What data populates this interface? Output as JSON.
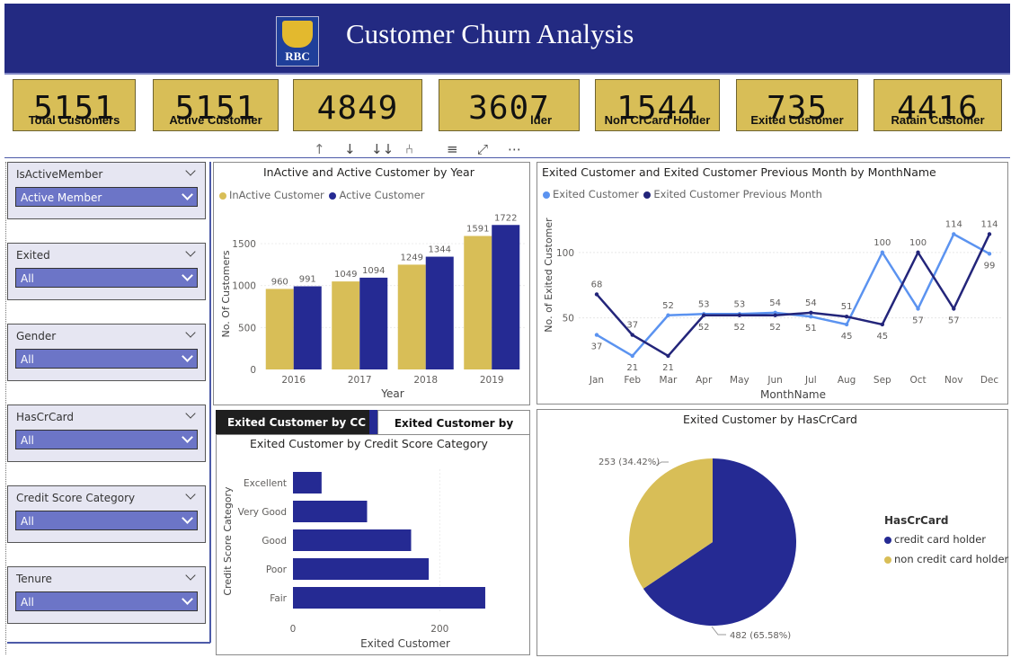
{
  "header": {
    "title": "Customer Churn Analysis",
    "logo_text": "RBC"
  },
  "kpis": [
    {
      "value": "5151",
      "label": "Total Customers"
    },
    {
      "value": "5151",
      "label": "Active Customer"
    },
    {
      "value": "4849",
      "label": ""
    },
    {
      "value": "3607",
      "label": "lder"
    },
    {
      "value": "1544",
      "label": "Non CrCard Holder"
    },
    {
      "value": "735",
      "label": "Exited Customer"
    },
    {
      "value": "4416",
      "label": "Ratain Customer"
    }
  ],
  "slicers": [
    {
      "title": "IsActiveMember",
      "value": "Active Member"
    },
    {
      "title": "Exited",
      "value": "All"
    },
    {
      "title": "Gender",
      "value": "All"
    },
    {
      "title": "HasCrCard",
      "value": "All"
    },
    {
      "title": "Credit Score Category",
      "value": "All"
    },
    {
      "title": "Tenure",
      "value": "All"
    }
  ],
  "toolbar": {
    "icons": [
      "arrow-up-icon",
      "arrow-down-icon",
      "double-arrow-down-icon",
      "expand-hierarchy-icon",
      "filter-icon",
      "focus-mode-icon",
      "more-options-icon"
    ]
  },
  "tabs": {
    "active": "Exited Customer by CC Cat",
    "inactive": "Exited Customer by Gender"
  },
  "colors": {
    "navy": "#252a93",
    "gold": "#d8be57",
    "light_blue": "#5b93f0",
    "dark_navy": "#23257a"
  },
  "chart_data": [
    {
      "type": "bar",
      "title": "InActive and Active Customer by Year",
      "xlabel": "Year",
      "ylabel": "No. Of Customers",
      "categories": [
        "2016",
        "2017",
        "2018",
        "2019"
      ],
      "series": [
        {
          "name": "InActive Customer",
          "values": [
            960,
            1049,
            1249,
            1591
          ]
        },
        {
          "name": "Active Customer",
          "values": [
            991,
            1094,
            1344,
            1722
          ]
        }
      ],
      "ylim": [
        0,
        1800
      ],
      "yticks": [
        "0",
        "500",
        "1000",
        "1500"
      ],
      "legend": "top-left"
    },
    {
      "type": "line",
      "title": "Exited Customer and Exited Customer Previous Month by MonthName",
      "xlabel": "MonthName",
      "ylabel": "No. of Exited Customer",
      "categories": [
        "Jan",
        "Feb",
        "Mar",
        "Apr",
        "May",
        "Jun",
        "Jul",
        "Aug",
        "Sep",
        "Oct",
        "Nov",
        "Dec"
      ],
      "series": [
        {
          "name": "Exited Customer",
          "values": [
            37,
            21,
            52,
            53,
            53,
            54,
            51,
            45,
            100,
            57,
            114,
            99
          ]
        },
        {
          "name": "Exited Customer Previous Month",
          "values": [
            68,
            37,
            21,
            52,
            52,
            52,
            54,
            51,
            45,
            100,
            57,
            114
          ]
        }
      ],
      "ylim": [
        12,
        126
      ],
      "yticks": [
        "50",
        "100"
      ],
      "legend": "top-left"
    },
    {
      "type": "bar",
      "orientation": "horizontal",
      "title": "Exited Customer by Credit Score Category",
      "xlabel": "Exited Customer",
      "ylabel": "Credit Score Category",
      "categories": [
        "Excellent",
        "Very Good",
        "Good",
        "Poor",
        "Fair"
      ],
      "values": [
        39,
        101,
        161,
        185,
        262
      ],
      "xlim": [
        0,
        300
      ],
      "xticks": [
        "0",
        "200"
      ]
    },
    {
      "type": "pie",
      "title": "Exited Customer by HasCrCard",
      "legend_title": "HasCrCard",
      "slices": [
        {
          "name": "credit card holder",
          "value": 482,
          "label": "482 (65.58%)"
        },
        {
          "name": "non credit card holder",
          "value": 253,
          "label": "253 (34.42%)"
        }
      ],
      "legend": "right"
    }
  ]
}
